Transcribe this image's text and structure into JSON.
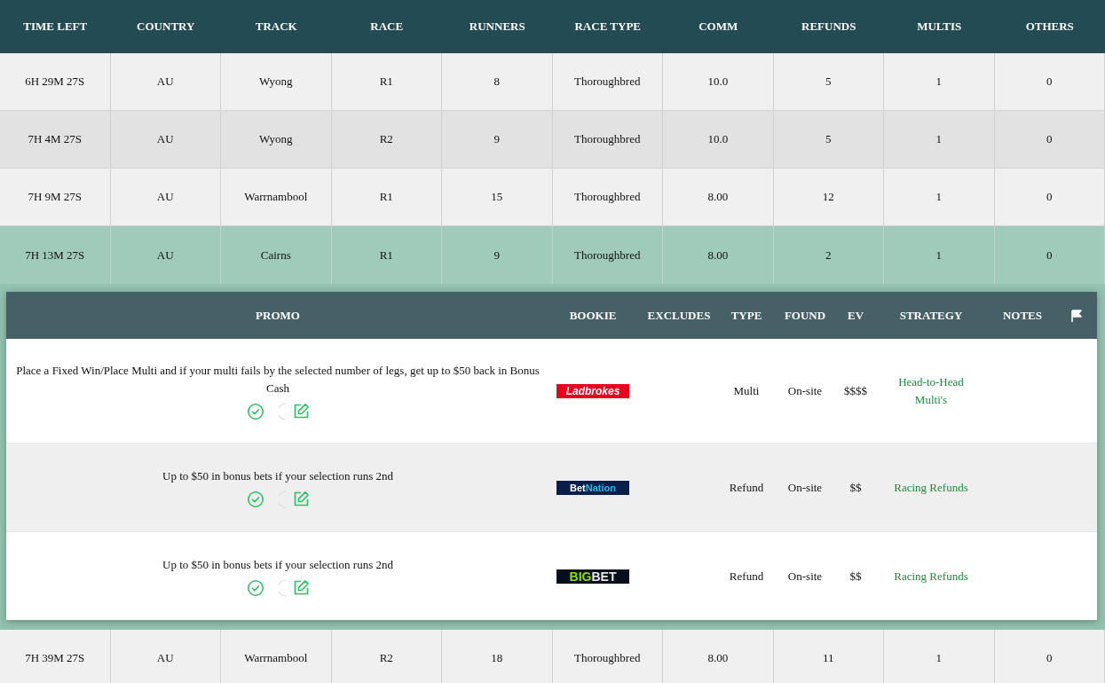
{
  "columns": [
    "TIME LEFT",
    "COUNTRY",
    "TRACK",
    "RACE",
    "RUNNERS",
    "RACE TYPE",
    "COMM",
    "REFUNDS",
    "MULTIS",
    "OTHERS"
  ],
  "rows": [
    {
      "cells": [
        "6H 29M 27S",
        "AU",
        "Wyong",
        "R1",
        "8",
        "Thoroughbred",
        "10.0",
        "5",
        "1",
        "0"
      ],
      "selected": false
    },
    {
      "cells": [
        "7H 4M 27S",
        "AU",
        "Wyong",
        "R2",
        "9",
        "Thoroughbred",
        "10.0",
        "5",
        "1",
        "0"
      ],
      "selected": false
    },
    {
      "cells": [
        "7H 9M 27S",
        "AU",
        "Warrnambool",
        "R1",
        "15",
        "Thoroughbred",
        "8.00",
        "12",
        "1",
        "0"
      ],
      "selected": false
    },
    {
      "cells": [
        "7H 13M 27S",
        "AU",
        "Cairns",
        "R1",
        "9",
        "Thoroughbred",
        "8.00",
        "2",
        "1",
        "0"
      ],
      "selected": true,
      "promos": {
        "columns": [
          "PROMO",
          "BOOKIE",
          "EXCLUDES",
          "TYPE",
          "FOUND",
          "EV",
          "STRATEGY",
          "NOTES"
        ],
        "rows": [
          {
            "promo": "Place a Fixed Win/Place Multi and if your multi fails by the selected number of legs, get up to $50 back in Bonus Cash",
            "bookie": {
              "kind": "ladbrokes",
              "parts": [
                "Ladbrokes"
              ]
            },
            "type": "Multi",
            "found": "On-site",
            "ev": "$$$$",
            "strategy": "Head-to-Head Multi's"
          },
          {
            "promo": "Up to $50 in bonus bets if your selection runs 2nd",
            "bookie": {
              "kind": "betnation",
              "parts": [
                "Bet",
                "Nation"
              ]
            },
            "type": "Refund",
            "found": "On-site",
            "ev": "$$",
            "strategy": "Racing Refunds"
          },
          {
            "promo": "Up to $50 in bonus bets if your selection runs 2nd",
            "bookie": {
              "kind": "bigbet",
              "parts": [
                "BIG",
                "BET"
              ]
            },
            "type": "Refund",
            "found": "On-site",
            "ev": "$$",
            "strategy": "Racing Refunds"
          }
        ]
      }
    },
    {
      "cells": [
        "7H 39M 27S",
        "AU",
        "Warrnambool",
        "R2",
        "18",
        "Thoroughbred",
        "8.00",
        "11",
        "1",
        "0"
      ],
      "selected": false
    }
  ]
}
